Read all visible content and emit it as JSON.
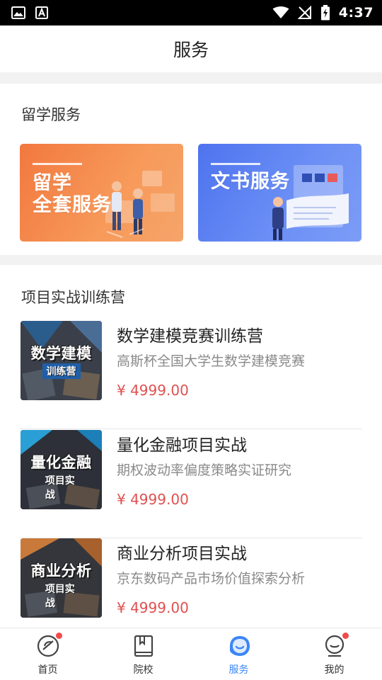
{
  "status_bar": {
    "time": "4:37",
    "left_icons": [
      "image-icon",
      "font-icon"
    ],
    "right_icons": [
      "wifi-icon",
      "signal-off-icon",
      "battery-charging-icon"
    ]
  },
  "header": {
    "title": "服务"
  },
  "study_abroad": {
    "title": "留学服务",
    "banners": [
      {
        "text_line1": "留学",
        "text_line2": "全套服务",
        "color": "#f2783f"
      },
      {
        "text_line1": "文书服务",
        "color": "#4e73ee"
      }
    ]
  },
  "bootcamp": {
    "title": "项目实战训练营",
    "items": [
      {
        "thumb_title": "数学建模",
        "thumb_sub": "训练营",
        "name": "数学建模竞赛训练营",
        "desc": "高斯杯全国大学生数学建模竞赛",
        "price": "¥ 4999.00"
      },
      {
        "thumb_title": "量化金融",
        "thumb_sub": "项目实战",
        "name": "量化金融项目实战",
        "desc": "期权波动率偏度策略实证研究",
        "price": "¥ 4999.00"
      },
      {
        "thumb_title": "商业分析",
        "thumb_sub": "项目实战",
        "name": "商业分析项目实战",
        "desc": "京东数码产品市场价值探索分析",
        "price": "¥ 4999.00"
      }
    ]
  },
  "bottom_nav": {
    "items": [
      {
        "label": "首页",
        "icon": "home-icon",
        "badge": true
      },
      {
        "label": "院校",
        "icon": "book-icon",
        "badge": false
      },
      {
        "label": "服务",
        "icon": "service-icon",
        "badge": false,
        "active": true
      },
      {
        "label": "我的",
        "icon": "profile-icon",
        "badge": true
      }
    ],
    "active_color": "#3a86f7"
  },
  "colors": {
    "price": "#e05050",
    "accent": "#3a86f7"
  }
}
